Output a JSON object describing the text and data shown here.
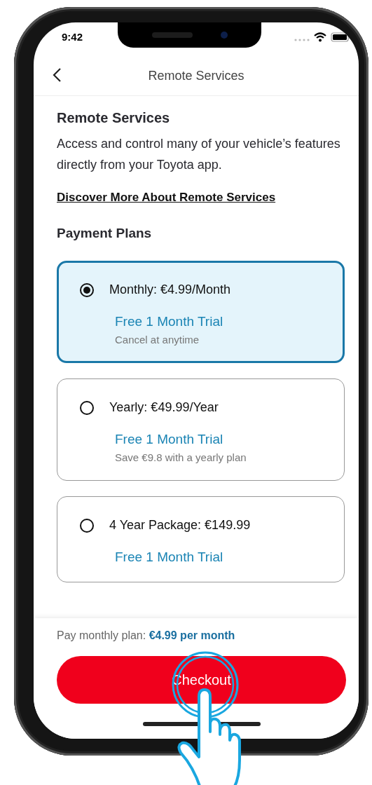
{
  "status_bar": {
    "time": "9:42"
  },
  "header": {
    "title": "Remote Services"
  },
  "section": {
    "title": "Remote Services",
    "description": "Access and control many of your vehicle’s features directly from your Toyota app.",
    "link": "Discover More About Remote Services"
  },
  "payment_plans": {
    "title": "Payment Plans",
    "plans": [
      {
        "name": "Monthly: €4.99/Month",
        "trial": "Free 1 Month Trial",
        "note": "Cancel at anytime",
        "selected": true
      },
      {
        "name": "Yearly: €49.99/Year",
        "trial": "Free 1 Month Trial",
        "note": "Save €9.8 with a yearly plan",
        "selected": false
      },
      {
        "name": "4 Year Package: €149.99",
        "trial": "Free 1 Month Trial",
        "selected": false
      }
    ]
  },
  "footer": {
    "summary": "Pay monthly plan: **€4.99 per month**",
    "button": "Checkout"
  }
}
